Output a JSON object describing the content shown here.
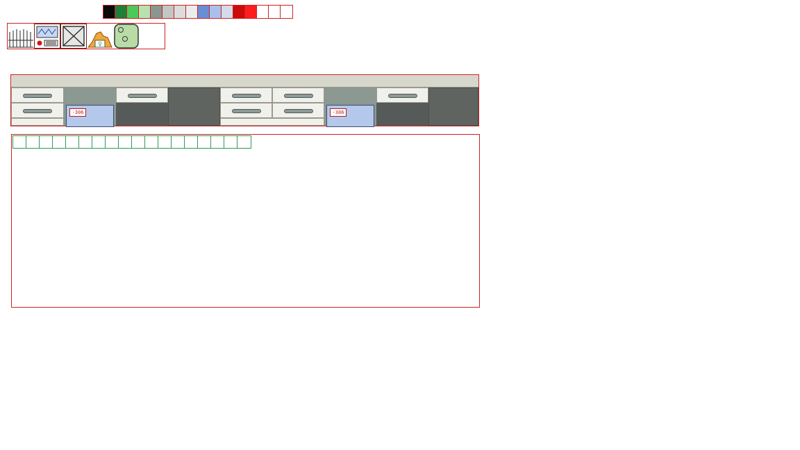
{
  "palette": {
    "colors": [
      "#0a0a0a",
      "#1f7e38",
      "#4dc95a",
      "#b7e2b0",
      "#8b9691",
      "#c3c7c4",
      "#dcdcdc",
      "#ececec",
      "#6a8ed6",
      "#a9c1ea",
      "#d4dcec",
      "#cc0b0b",
      "#ff1e1e",
      "#ffffff",
      "#ffffff",
      "#ffffff"
    ]
  },
  "toolbar": {
    "tools": [
      {
        "icon": "pipette-rack-icon"
      },
      {
        "icon": "oscilloscope-icon"
      },
      {
        "icon": "crossed-box-icon"
      },
      {
        "icon": "mountain-sample-icon"
      },
      {
        "icon": "petri-dish-icon"
      }
    ]
  },
  "bench": {
    "readouts": [
      "-306",
      "-306"
    ]
  },
  "workspace": {
    "slot_count": 18
  }
}
